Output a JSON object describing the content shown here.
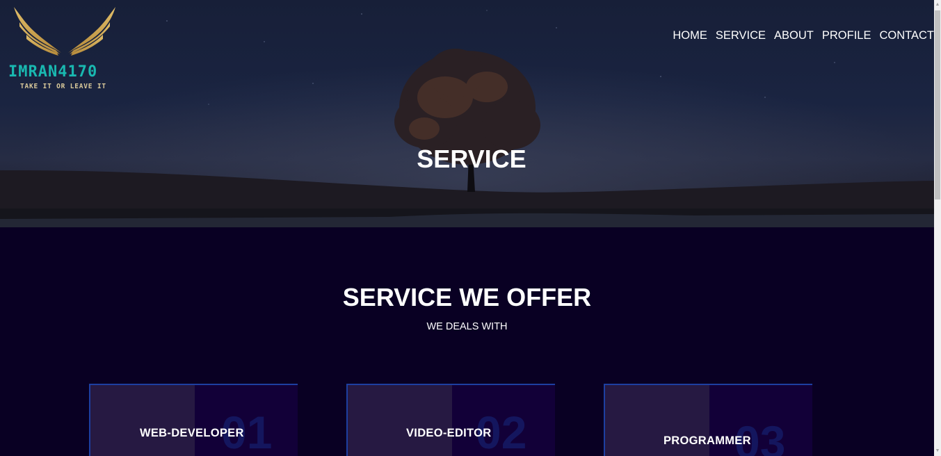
{
  "logo": {
    "name": "IMRAN4170",
    "tagline": "TAKE IT OR LEAVE IT"
  },
  "nav": [
    "HOME",
    "SERVICE",
    "ABOUT",
    "PROFILE",
    "CONTACT"
  ],
  "hero": {
    "title": "SERVICE"
  },
  "services": {
    "title": "SERVICE WE OFFER",
    "subtitle": "WE DEALS WITH",
    "cards": [
      {
        "label": "WEB-DEVELOPER",
        "number": "01"
      },
      {
        "label": "VIDEO-EDITOR",
        "number": "02"
      },
      {
        "label": "PROGRAMMER",
        "number": "03"
      }
    ]
  },
  "colors": {
    "background": "#090023",
    "card_left": "#261942",
    "card_right": "#120038",
    "card_border": "#1d3fa1",
    "logo_teal": "#19b8b0",
    "logo_gold": "#c9a24a"
  }
}
